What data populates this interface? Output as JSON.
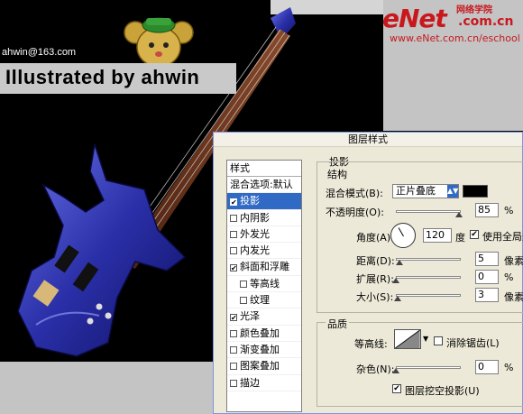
{
  "logo": {
    "brand": "eNet",
    "cn": "网络学院",
    "com": ".com.cn",
    "url": "www.eNet.com.cn/eschool"
  },
  "artwork": {
    "email": "ahwin@163.com",
    "credit": "Illustrated by ahwin"
  },
  "dialog": {
    "title": "图层样式",
    "styles_header": "样式",
    "styles": [
      {
        "label": "混合选项:默认",
        "checkbox": false,
        "checked": false,
        "selected": false,
        "indent": false
      },
      {
        "label": "投影",
        "checkbox": true,
        "checked": true,
        "selected": true,
        "indent": false
      },
      {
        "label": "内阴影",
        "checkbox": true,
        "checked": false,
        "selected": false,
        "indent": false
      },
      {
        "label": "外发光",
        "checkbox": true,
        "checked": false,
        "selected": false,
        "indent": false
      },
      {
        "label": "内发光",
        "checkbox": true,
        "checked": false,
        "selected": false,
        "indent": false
      },
      {
        "label": "斜面和浮雕",
        "checkbox": true,
        "checked": true,
        "selected": false,
        "indent": false
      },
      {
        "label": "等高线",
        "checkbox": true,
        "checked": false,
        "selected": false,
        "indent": true
      },
      {
        "label": "纹理",
        "checkbox": true,
        "checked": false,
        "selected": false,
        "indent": true
      },
      {
        "label": "光泽",
        "checkbox": true,
        "checked": true,
        "selected": false,
        "indent": false
      },
      {
        "label": "颜色叠加",
        "checkbox": true,
        "checked": false,
        "selected": false,
        "indent": false
      },
      {
        "label": "渐变叠加",
        "checkbox": true,
        "checked": false,
        "selected": false,
        "indent": false
      },
      {
        "label": "图案叠加",
        "checkbox": true,
        "checked": false,
        "selected": false,
        "indent": false
      },
      {
        "label": "描边",
        "checkbox": true,
        "checked": false,
        "selected": false,
        "indent": false
      }
    ],
    "drop_shadow": {
      "section": "投影",
      "structure": "结构",
      "blend_mode_label": "混合模式(B):",
      "blend_mode_value": "正片叠底",
      "shadow_color": "#000000",
      "opacity_label": "不透明度(O):",
      "opacity_value": "85",
      "opacity_unit": "%",
      "angle_label": "角度(A):",
      "angle_value": "120",
      "angle_unit": "度",
      "global_light_label": "使用全局光",
      "global_light_checked": true,
      "distance_label": "距离(D):",
      "distance_value": "5",
      "distance_unit": "像素",
      "spread_label": "扩展(R):",
      "spread_value": "0",
      "spread_unit": "%",
      "size_label": "大小(S):",
      "size_value": "3",
      "size_unit": "像素",
      "quality": "品质",
      "contour_label": "等高线:",
      "antialias_label": "消除锯齿(L)",
      "antialias_checked": false,
      "noise_label": "杂色(N):",
      "noise_value": "0",
      "noise_unit": "%",
      "knockout_label": "图层挖空投影(U)",
      "knockout_checked": true
    }
  }
}
